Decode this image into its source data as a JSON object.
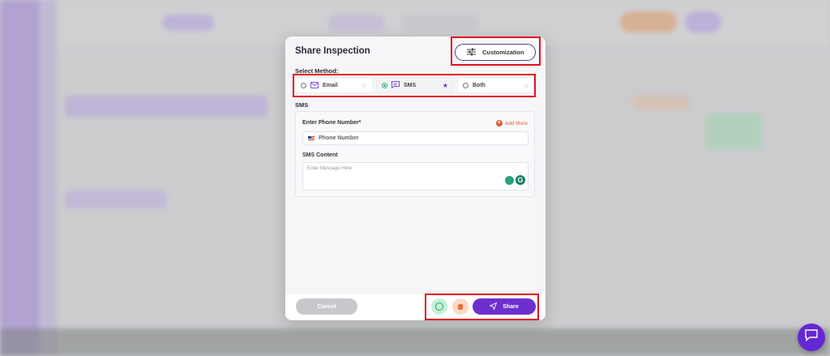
{
  "modal": {
    "title": "Share Inspection",
    "customization_label": "Customization",
    "select_method_label": "Select Method:",
    "methods": [
      {
        "label": "Email",
        "selected": false,
        "starred": false,
        "icon": "mail-icon"
      },
      {
        "label": "SMS",
        "selected": true,
        "starred": true,
        "icon": "sms-icon"
      },
      {
        "label": "Both",
        "selected": false,
        "starred": false,
        "icon": ""
      }
    ],
    "section_label": "SMS",
    "phone": {
      "label": "Enter Phone Number*",
      "add_more": "Add More",
      "placeholder": "Phone Number"
    },
    "content": {
      "label": "SMS Content",
      "placeholder": "Enter Message Here"
    },
    "footer": {
      "cancel_label": "Cancel",
      "share_label": "Share"
    }
  },
  "colors": {
    "accent": "#6e2fcf",
    "highlight": "#e3121e",
    "add_more": "#e35d32",
    "whatsapp": "#25a952"
  }
}
